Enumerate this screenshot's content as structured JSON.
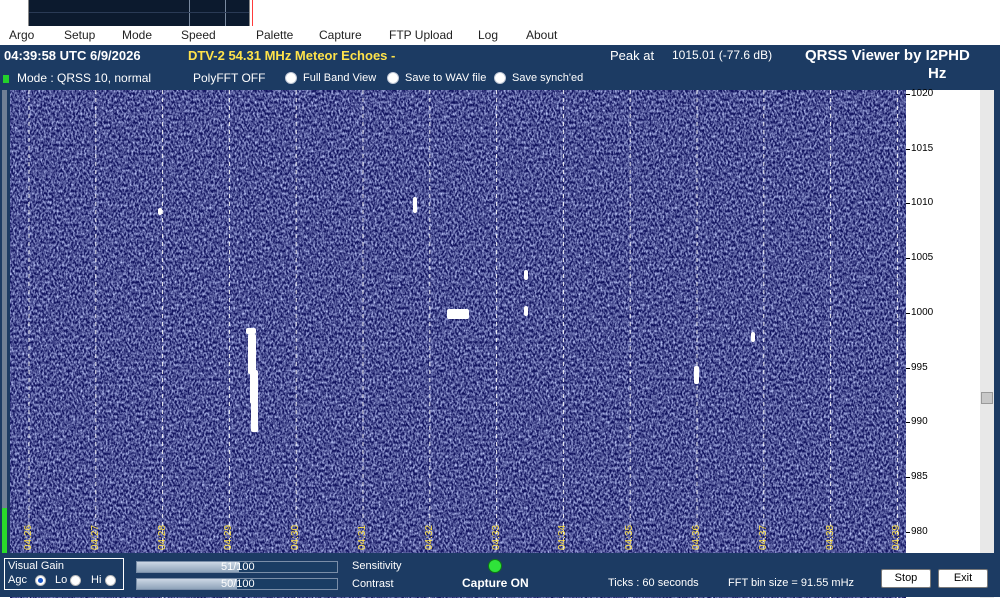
{
  "menu": [
    "Argo",
    "Setup",
    "Mode",
    "Speed",
    "Palette",
    "Capture",
    "FTP Upload",
    "Log",
    "About"
  ],
  "status": {
    "time": "04:39:58 UTC  6/9/2026",
    "title": "DTV-2 54.31 MHz Meteor Echoes -",
    "peak_label": "Peak at",
    "peak_value": "1015.01 (-77.6 dB)",
    "app_title": "QRSS Viewer by I2PHD",
    "unit": "Hz"
  },
  "mode": {
    "mode_text": "Mode : QRSS 10, normal",
    "polyfft": "PolyFFT OFF",
    "full_band_view": "Full Band View",
    "save_wav": "Save to WAV file",
    "save_synched": "Save synch'ed"
  },
  "freq_ticks": [
    "1020",
    "1015",
    "1010",
    "1005",
    "1000",
    "995",
    "990",
    "985",
    "980"
  ],
  "time_ticks": [
    "04:26",
    "04:27",
    "04:28",
    "04:29",
    "04:30",
    "04:31",
    "04:32",
    "04:33",
    "04:34",
    "04:35",
    "04:36",
    "04:37",
    "04:38",
    "04:39"
  ],
  "bottom": {
    "visual_gain": "Visual Gain",
    "agc": "Agc",
    "lo": "Lo",
    "hi": "Hi",
    "sensitivity_value": "51/100",
    "sensitivity_level": 0.51,
    "sensitivity_label": "Sensitivity",
    "contrast_value": "50/100",
    "contrast_level": 0.5,
    "contrast_label": "Contrast",
    "capture": "Capture ON",
    "ticks": "Ticks   : 60 seconds",
    "fft_bin": "FFT bin size = 91.55 mHz",
    "stop": "Stop",
    "exit": "Exit"
  },
  "colors": {
    "waterfall_bg": "#10125e",
    "panel": "#1c3b63",
    "accent_yellow": "#ffe34a",
    "capture_led": "#2fe23a"
  }
}
